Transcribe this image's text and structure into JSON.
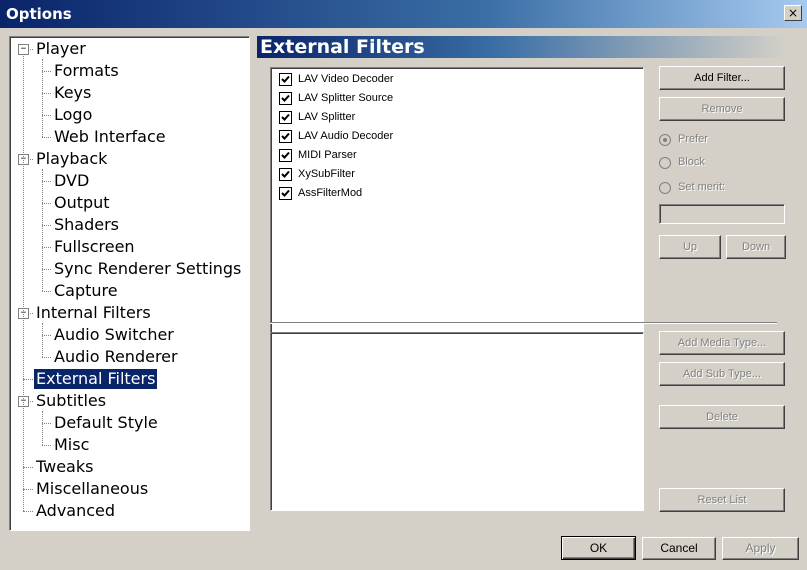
{
  "window": {
    "title": "Options",
    "close_glyph": "×"
  },
  "tree": {
    "items": [
      {
        "label": "Player",
        "level": 0,
        "expander": "−"
      },
      {
        "label": "Formats",
        "level": 1
      },
      {
        "label": "Keys",
        "level": 1
      },
      {
        "label": "Logo",
        "level": 1
      },
      {
        "label": "Web Interface",
        "level": 1
      },
      {
        "label": "Playback",
        "level": 0,
        "expander": "−"
      },
      {
        "label": "DVD",
        "level": 1
      },
      {
        "label": "Output",
        "level": 1
      },
      {
        "label": "Shaders",
        "level": 1
      },
      {
        "label": "Fullscreen",
        "level": 1
      },
      {
        "label": "Sync Renderer Settings",
        "level": 1
      },
      {
        "label": "Capture",
        "level": 1
      },
      {
        "label": "Internal Filters",
        "level": 0,
        "expander": "−"
      },
      {
        "label": "Audio Switcher",
        "level": 1
      },
      {
        "label": "Audio Renderer",
        "level": 1
      },
      {
        "label": "External Filters",
        "level": 0,
        "selected": true
      },
      {
        "label": "Subtitles",
        "level": 0,
        "expander": "−"
      },
      {
        "label": "Default Style",
        "level": 1
      },
      {
        "label": "Misc",
        "level": 1
      },
      {
        "label": "Tweaks",
        "level": 0
      },
      {
        "label": "Miscellaneous",
        "level": 0
      },
      {
        "label": "Advanced",
        "level": 0
      }
    ]
  },
  "page": {
    "header": "External Filters"
  },
  "filters": [
    {
      "label": "LAV Video Decoder",
      "checked": true
    },
    {
      "label": "LAV Splitter Source",
      "checked": true
    },
    {
      "label": "LAV Splitter",
      "checked": true
    },
    {
      "label": "LAV Audio Decoder",
      "checked": true
    },
    {
      "label": "MIDI Parser",
      "checked": true
    },
    {
      "label": "XySubFilter",
      "checked": true
    },
    {
      "label": "AssFilterMod",
      "checked": true
    }
  ],
  "buttons": {
    "add_filter": "Add Filter...",
    "remove": "Remove",
    "up": "Up",
    "down": "Down",
    "add_media_type": "Add Media Type...",
    "add_sub_type": "Add Sub Type...",
    "delete": "Delete",
    "reset_list": "Reset List",
    "ok": "OK",
    "cancel": "Cancel",
    "apply": "Apply"
  },
  "merit": {
    "prefer": "Prefer",
    "block": "Block",
    "set_merit": "Set merit:",
    "selected": "prefer",
    "value": ""
  },
  "colors": {
    "selection": "#0a246a",
    "face": "#d4d0c8"
  }
}
